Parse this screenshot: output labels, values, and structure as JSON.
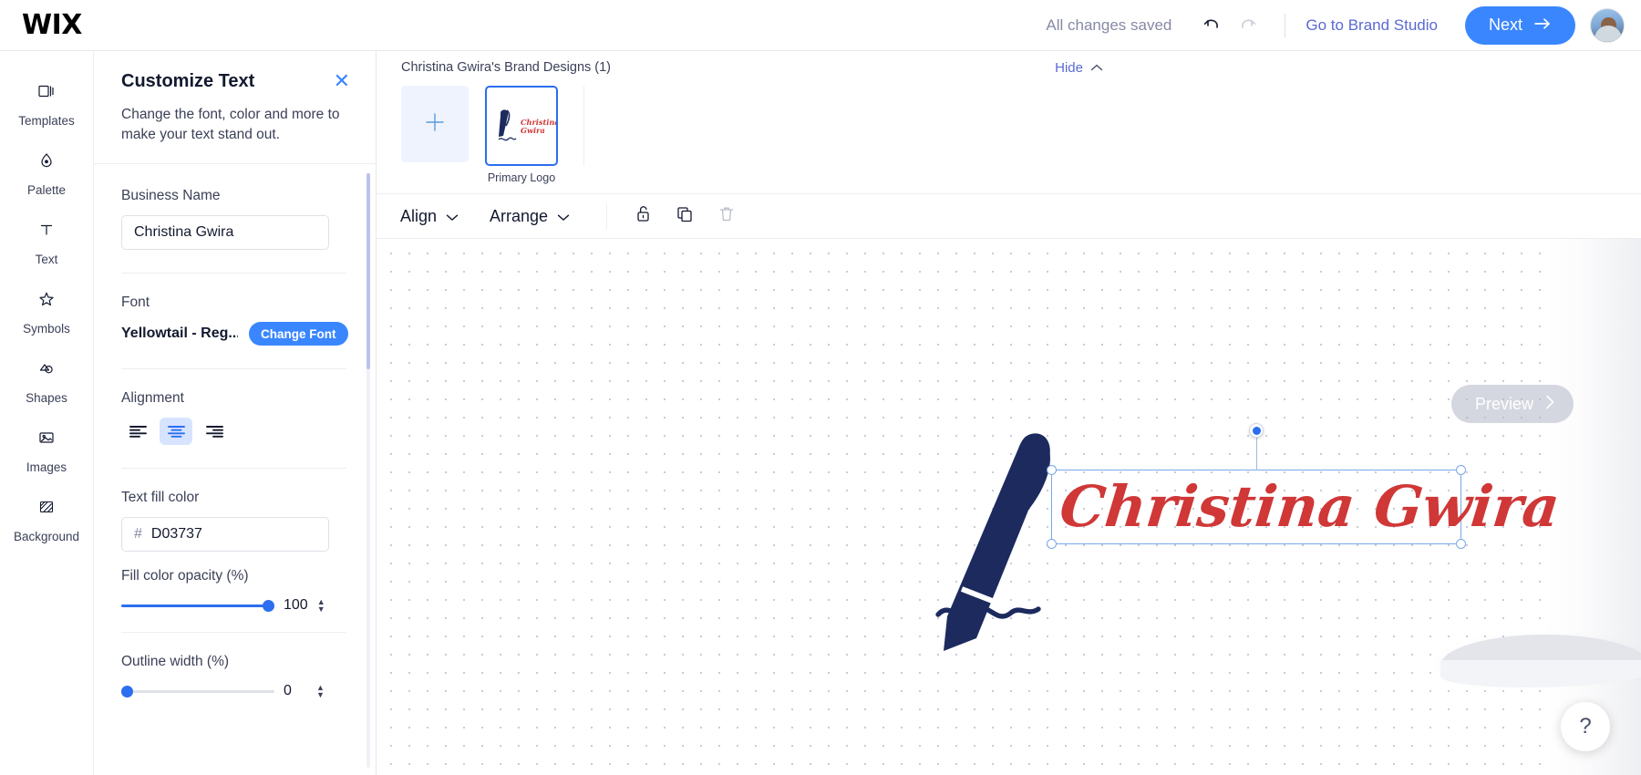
{
  "topbar": {
    "logo": "WIX",
    "saved_status": "All changes saved",
    "undo_icon": "undo-icon",
    "redo_icon": "redo-icon",
    "brand_studio_link": "Go to Brand Studio",
    "next_label": "Next",
    "next_arrow": "arrow-right-icon",
    "avatar": "user-avatar",
    "accent_blue": "#3a86ff",
    "link_blue": "#5a6ad4"
  },
  "sidebar": {
    "items": [
      {
        "label": "Templates",
        "icon": "templates-icon"
      },
      {
        "label": "Palette",
        "icon": "palette-droplet-icon"
      },
      {
        "label": "Text",
        "icon": "text-t-icon"
      },
      {
        "label": "Symbols",
        "icon": "star-icon"
      },
      {
        "label": "Shapes",
        "icon": "shapes-icon"
      },
      {
        "label": "Images",
        "icon": "image-icon"
      },
      {
        "label": "Background",
        "icon": "background-hatch-icon"
      }
    ]
  },
  "panel": {
    "title": "Customize Text",
    "close_icon": "close-x-icon",
    "subtitle": "Change the font, color and more to make your text stand out.",
    "business_name": {
      "label": "Business Name",
      "value": "Christina Gwira",
      "placeholder": "Business Name"
    },
    "font": {
      "label": "Font",
      "value": "Yellowtail - Reg...",
      "change_button": "Change Font"
    },
    "alignment": {
      "label": "Alignment",
      "options": [
        "align-left",
        "align-center",
        "align-right"
      ],
      "selected": "align-center"
    },
    "text_fill_color": {
      "label": "Text fill color",
      "hash": "#",
      "value": "D03737",
      "swatch_hex": "#D03737"
    },
    "fill_opacity": {
      "label": "Fill color opacity (%)",
      "value": "100",
      "percent": 100
    },
    "outline_width": {
      "label": "Outline width (%)",
      "value": "0",
      "percent": 0
    }
  },
  "designs": {
    "title": "Christina Gwira's Brand Designs (1)",
    "hide_label": "Hide",
    "hide_chevron": "chevron-up-icon",
    "add_icon": "plus-icon",
    "thumbnails": [
      {
        "label": "Primary Logo",
        "selected": true,
        "text": "Christina Gwira"
      }
    ]
  },
  "toolbar": {
    "align_label": "Align",
    "arrange_label": "Arrange",
    "chevron": "chevron-down-icon",
    "lock_icon": "unlock-icon",
    "duplicate_icon": "duplicate-icon",
    "delete_icon": "trash-icon"
  },
  "canvas": {
    "logo_text": "Christina Gwira",
    "logo_color": "#D03737",
    "pen_color": "#1c2a5e",
    "preview_label": "Preview",
    "preview_chevron": "chevron-right-icon",
    "help_label": "?"
  }
}
